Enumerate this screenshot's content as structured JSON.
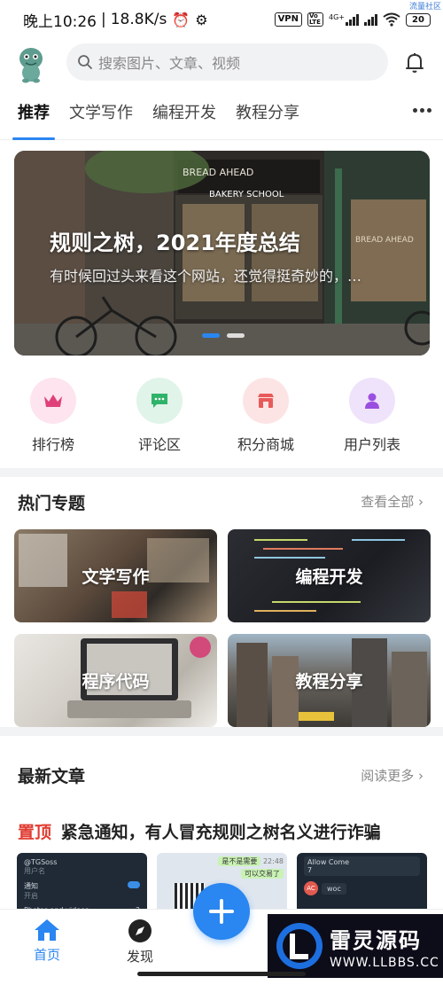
{
  "statusbar": {
    "time": "晚上10:26",
    "speed": "18.8K/s",
    "vpn": "VPN",
    "volte": "Vo LTE",
    "net": "4G+",
    "battery": "20",
    "corner": "流量社区"
  },
  "search": {
    "placeholder": "搜索图片、文章、视频"
  },
  "tabs": [
    "推荐",
    "文学写作",
    "编程开发",
    "教程分享"
  ],
  "banner": {
    "title": "规则之树，2021年度总结",
    "subtitle": "有时候回过头来看这个网站，还觉得挺奇妙的，…"
  },
  "quick": [
    {
      "label": "排行榜",
      "icon": "crown-icon",
      "bg": "#fde4ee",
      "fg": "#e0407a"
    },
    {
      "label": "评论区",
      "icon": "comment-icon",
      "bg": "#e0f4e9",
      "fg": "#2fb36a"
    },
    {
      "label": "积分商城",
      "icon": "shop-icon",
      "bg": "#fde4e4",
      "fg": "#e85a5a"
    },
    {
      "label": "用户列表",
      "icon": "user-icon",
      "bg": "#efe3fb",
      "fg": "#9b4fe0"
    }
  ],
  "topics": {
    "title": "热门专题",
    "more": "查看全部",
    "items": [
      "文学写作",
      "编程开发",
      "程序代码",
      "教程分享"
    ]
  },
  "latest": {
    "title": "最新文章",
    "more": "阅读更多",
    "pin": "置顶",
    "headline": "紧急通知，有人冒充规则之树名义进行诈骗"
  },
  "thumbs": {
    "t1": {
      "head": "@TGSoss",
      "sub": "用户名",
      "item1": "通知",
      "item2": "开启",
      "item3": "Photos and videos",
      "num": "3"
    },
    "t2": {
      "b1": "是不是需要",
      "b2": "可以交易了",
      "time": "22:48"
    },
    "t3": {
      "head": "Allow Come",
      "num": "7",
      "name": "woc",
      "av": "AC"
    }
  },
  "tabbar": {
    "home": "首页",
    "discover": "发现"
  },
  "watermark": {
    "big": "雷灵源码",
    "small": "WWW.LLBBS.CC"
  }
}
